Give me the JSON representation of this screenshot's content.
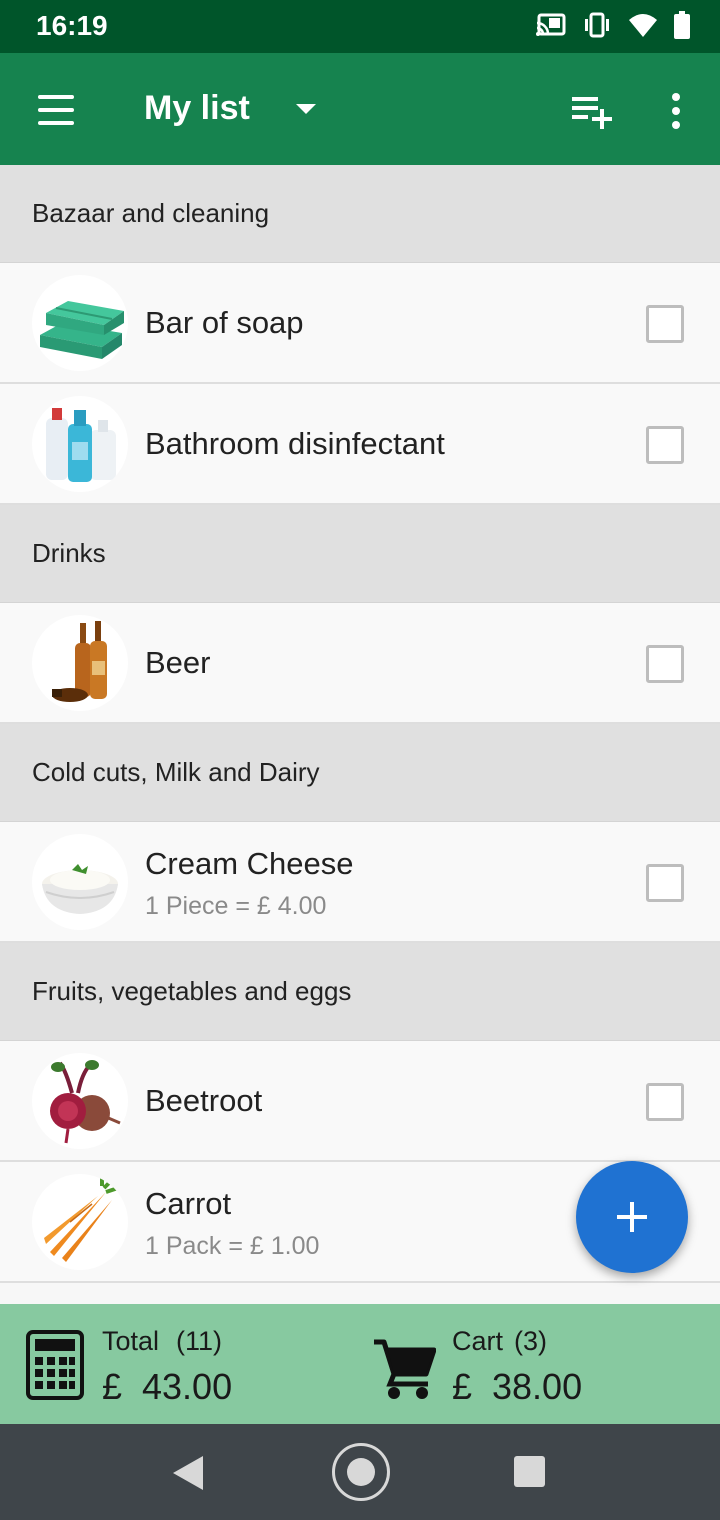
{
  "status_bar": {
    "time": "16:19",
    "icons": [
      "cast-icon",
      "vibrate-icon",
      "wifi-icon",
      "battery-icon"
    ]
  },
  "app_bar": {
    "title": "My list",
    "icons": [
      "menu-icon",
      "dropdown-arrow-icon",
      "add-list-icon",
      "more-vert-icon"
    ]
  },
  "list": {
    "categories": [
      {
        "name": "Bazaar and cleaning",
        "items": [
          {
            "name": "Bar of soap",
            "detail": "",
            "icon": "soap-icon"
          },
          {
            "name": "Bathroom disinfectant",
            "detail": "",
            "icon": "cleaning-bottles-icon"
          }
        ]
      },
      {
        "name": "Drinks",
        "items": [
          {
            "name": "Beer",
            "detail": "",
            "icon": "beer-bottles-icon"
          }
        ]
      },
      {
        "name": "Cold cuts, Milk and Dairy",
        "items": [
          {
            "name": "Cream Cheese",
            "detail": "1 Piece = £ 4.00",
            "icon": "cream-cheese-bowl-icon"
          }
        ]
      },
      {
        "name": "Fruits, vegetables and eggs",
        "items": [
          {
            "name": "Beetroot",
            "detail": "",
            "icon": "beetroot-icon"
          },
          {
            "name": "Carrot",
            "detail": "1 Pack = £ 1.00",
            "icon": "carrot-icon"
          }
        ]
      }
    ]
  },
  "fab": {
    "icon": "plus-icon"
  },
  "summary": {
    "total_label": "Total",
    "total_count": "(11)",
    "total_currency": "£",
    "total_value": "43.00",
    "cart_label": "Cart",
    "cart_count": "(3)",
    "cart_currency": "£",
    "cart_value": "38.00"
  },
  "colors": {
    "status_bar": "#00552a",
    "app_bar": "#16834f",
    "fab": "#1f72d2",
    "summary_bar": "#87c9a0",
    "nav_bar": "#3f454a"
  }
}
